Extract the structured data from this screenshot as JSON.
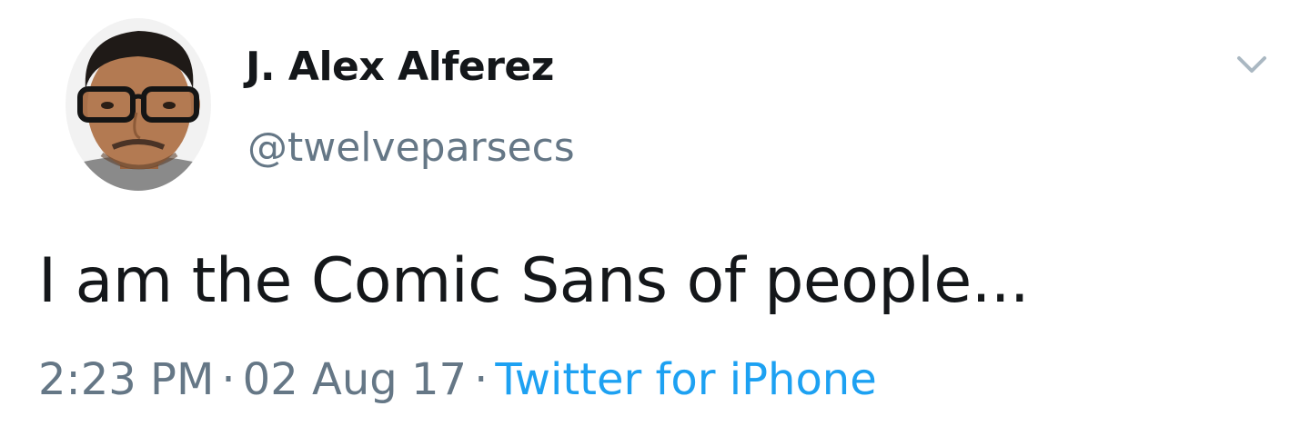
{
  "author": {
    "display_name": "J. Alex Alferez",
    "handle": "@twelveparsecs"
  },
  "tweet": {
    "text": "I am the Comic Sans of people..."
  },
  "meta": {
    "time": "2:23 PM",
    "separator": "·",
    "date": "02 Aug 17",
    "source": "Twitter for iPhone"
  },
  "icons": {
    "menu": "chevron-down-icon"
  },
  "colors": {
    "text": "#14171a",
    "secondary": "#657786",
    "link": "#1da1f2",
    "icon": "#aab8c2"
  }
}
